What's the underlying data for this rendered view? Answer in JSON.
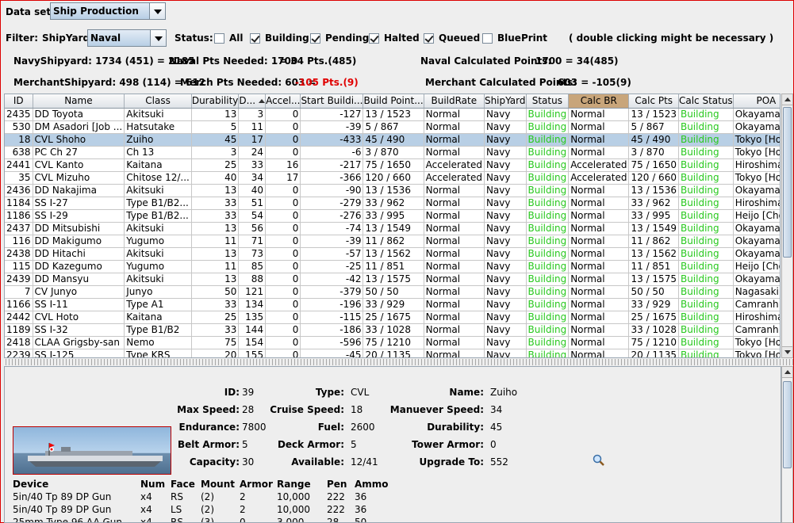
{
  "toolbar": {
    "dataset_label": "Data set:",
    "dataset_value": "Ship Production",
    "filter_label": "Filter:",
    "shipyard_label": "ShipYard:",
    "shipyard_value": "Naval",
    "status_label": "Status:",
    "checkboxes": [
      {
        "label": "All",
        "checked": false
      },
      {
        "label": "Building",
        "checked": true
      },
      {
        "label": "Pending",
        "checked": true
      },
      {
        "label": "Halted",
        "checked": true
      },
      {
        "label": "Queued",
        "checked": true
      },
      {
        "label": "BluePrint",
        "checked": false
      }
    ],
    "hint": "( double clicking might be necessary )"
  },
  "summary": {
    "navy_shipyard": "NavyShipyard: 1734 (451) = 2185",
    "naval_pts_needed": "Naval Pts Needed: 1700",
    "naval_pts_result": "= 34 Pts.(485)",
    "naval_calc": "Naval Calculated Points:",
    "naval_calc_value": "1700 = 34(485)",
    "merchant_shipyard": "MerchantShipyard: 498 (114) = 612",
    "merch_pts_needed": "Merch Pts Needed: 603 =",
    "merch_pts_result": "-105 Pts.(9)",
    "merchant_calc": "Merchant Calculated Points:",
    "merchant_calc_value": "603 = -105(9)",
    "negative_color": "#e00000"
  },
  "table": {
    "columns": [
      "ID",
      "Name",
      "Class",
      "Durability",
      "D...",
      "Accel...",
      "Start Buildi...",
      "Build Point...",
      "BuildRate",
      "ShipYard",
      "Status",
      "Calc BR",
      "Calc Pts",
      "Calc Status",
      "POA"
    ],
    "rows": [
      [
        "2435",
        "DD Toyota",
        "Akitsuki",
        "13",
        "3",
        "0",
        "-127",
        "13 / 1523",
        "Normal",
        "Navy",
        "Building",
        "Normal",
        "13 / 1523",
        "Building",
        "Okayama [..."
      ],
      [
        "530",
        "DM Asadori [Job ...",
        "Hatsutake",
        "5",
        "11",
        "0",
        "-39",
        "5 / 867",
        "Normal",
        "Navy",
        "Building",
        "Normal",
        "5 / 867",
        "Building",
        "Okayama [..."
      ],
      [
        "18",
        "CVL Shoho",
        "Zuiho",
        "45",
        "17",
        "0",
        "-433",
        "45 / 490",
        "Normal",
        "Navy",
        "Building",
        "Normal",
        "45 / 490",
        "Building",
        "Tokyo [Hon..."
      ],
      [
        "638",
        "PC Ch 27",
        "Ch 13",
        "3",
        "24",
        "0",
        "-6",
        "3 / 870",
        "Normal",
        "Navy",
        "Building",
        "Normal",
        "3 / 870",
        "Building",
        "Tokyo [Hon..."
      ],
      [
        "2441",
        "CVL Kanto",
        "Kaitana",
        "25",
        "33",
        "16",
        "-217",
        "75 / 1650",
        "Accelerated",
        "Navy",
        "Building",
        "Accelerated",
        "75 / 1650",
        "Building",
        "Hiroshima/..."
      ],
      [
        "35",
        "CVL Mizuho",
        "Chitose 12/...",
        "40",
        "34",
        "17",
        "-366",
        "120 / 660",
        "Accelerated",
        "Navy",
        "Building",
        "Accelerated",
        "120 / 660",
        "Building",
        "Tokyo [Hon..."
      ],
      [
        "2436",
        "DD Nakajima",
        "Akitsuki",
        "13",
        "40",
        "0",
        "-90",
        "13 / 1536",
        "Normal",
        "Navy",
        "Building",
        "Normal",
        "13 / 1536",
        "Building",
        "Okayama [..."
      ],
      [
        "1184",
        "SS I-27",
        "Type B1/B2...",
        "33",
        "51",
        "0",
        "-279",
        "33 / 962",
        "Normal",
        "Navy",
        "Building",
        "Normal",
        "33 / 962",
        "Building",
        "Hiroshima/..."
      ],
      [
        "1186",
        "SS I-29",
        "Type B1/B2...",
        "33",
        "54",
        "0",
        "-276",
        "33 / 995",
        "Normal",
        "Navy",
        "Building",
        "Normal",
        "33 / 995",
        "Building",
        "Heijo [Cho..."
      ],
      [
        "2437",
        "DD Mitsubishi",
        "Akitsuki",
        "13",
        "56",
        "0",
        "-74",
        "13 / 1549",
        "Normal",
        "Navy",
        "Building",
        "Normal",
        "13 / 1549",
        "Building",
        "Okayama [..."
      ],
      [
        "116",
        "DD Makigumo",
        "Yugumo",
        "11",
        "71",
        "0",
        "-39",
        "11 / 862",
        "Normal",
        "Navy",
        "Building",
        "Normal",
        "11 / 862",
        "Building",
        "Okayama [..."
      ],
      [
        "2438",
        "DD Hitachi",
        "Akitsuki",
        "13",
        "73",
        "0",
        "-57",
        "13 / 1562",
        "Normal",
        "Navy",
        "Building",
        "Normal",
        "13 / 1562",
        "Building",
        "Okayama [..."
      ],
      [
        "115",
        "DD Kazegumo",
        "Yugumo",
        "11",
        "85",
        "0",
        "-25",
        "11 / 851",
        "Normal",
        "Navy",
        "Building",
        "Normal",
        "11 / 851",
        "Building",
        "Heijo [Cho..."
      ],
      [
        "2439",
        "DD Mansyu",
        "Akitsuki",
        "13",
        "88",
        "0",
        "-42",
        "13 / 1575",
        "Normal",
        "Navy",
        "Building",
        "Normal",
        "13 / 1575",
        "Building",
        "Okayama [..."
      ],
      [
        "7",
        "CV Junyo",
        "Junyo",
        "50",
        "121",
        "0",
        "-379",
        "50 / 50",
        "Normal",
        "Navy",
        "Building",
        "Normal",
        "50 / 50",
        "Building",
        "Nagasaki [..."
      ],
      [
        "1166",
        "SS I-11",
        "Type A1",
        "33",
        "134",
        "0",
        "-196",
        "33 / 929",
        "Normal",
        "Navy",
        "Building",
        "Normal",
        "33 / 929",
        "Building",
        "Camranh B..."
      ],
      [
        "2442",
        "CVL Hoto",
        "Kaitana",
        "25",
        "135",
        "0",
        "-115",
        "25 / 1675",
        "Normal",
        "Navy",
        "Building",
        "Normal",
        "25 / 1675",
        "Building",
        "Hiroshima/..."
      ],
      [
        "1189",
        "SS I-32",
        "Type B1/B2",
        "33",
        "144",
        "0",
        "-186",
        "33 / 1028",
        "Normal",
        "Navy",
        "Building",
        "Normal",
        "33 / 1028",
        "Building",
        "Camranh B..."
      ],
      [
        "2418",
        "CLAA Grigsby-san",
        "Nemo",
        "75",
        "154",
        "0",
        "-596",
        "75 / 1210",
        "Normal",
        "Navy",
        "Building",
        "Normal",
        "75 / 1210",
        "Building",
        "Tokyo [Hon..."
      ],
      [
        "2239",
        "SS I-125",
        "Type KRS",
        "20",
        "155",
        "0",
        "-45",
        "20 / 1135",
        "Normal",
        "Navy",
        "Building",
        "Normal",
        "20 / 1135",
        "Building",
        "Tokyo [Hon..."
      ]
    ],
    "selected_row": 2,
    "status_color": "#28c81e"
  },
  "detail": {
    "id_label": "ID:",
    "id": "39",
    "type_label": "Type:",
    "type": "CVL",
    "name_label": "Name:",
    "name": "Zuiho",
    "maxspeed_label": "Max Speed:",
    "maxspeed": "28",
    "cruise_label": "Cruise Speed:",
    "cruise": "18",
    "maneuver_label": "Manuever Speed:",
    "maneuver": "34",
    "endurance_label": "Endurance:",
    "endurance": "7800",
    "fuel_label": "Fuel:",
    "fuel": "2600",
    "durability_label": "Durability:",
    "durability": "45",
    "belt_label": "Belt Armor:",
    "belt": "5",
    "deck_label": "Deck Armor:",
    "deck": "5",
    "tower_label": "Tower Armor:",
    "tower": "0",
    "capacity_label": "Capacity:",
    "capacity": "30",
    "available_label": "Available:",
    "available": "12/41",
    "upgrade_label": "Upgrade To:",
    "upgrade": "552",
    "device_headers": [
      "Device",
      "Num",
      "Face",
      "Mount",
      "Armor",
      "Range",
      "Pen",
      "Ammo"
    ],
    "devices": [
      [
        "5in/40 Tp 89 DP Gun",
        "x4",
        "RS",
        "(2)",
        "2",
        "10,000",
        "222",
        "36"
      ],
      [
        "5in/40 Tp 89 DP Gun",
        "x4",
        "LS",
        "(2)",
        "2",
        "10,000",
        "222",
        "36"
      ],
      [
        "25mm Type 96 AA Gun",
        "x4",
        "RS",
        "(3)",
        "0",
        "3,000",
        "28",
        "50"
      ]
    ],
    "magnifier_icon": "magnifier-icon",
    "ship_image_icon": "ship-silhouette-icon"
  }
}
